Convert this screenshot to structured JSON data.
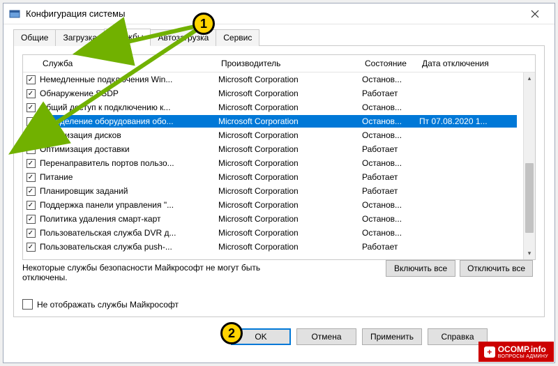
{
  "window": {
    "title": "Конфигурация системы"
  },
  "tabs": {
    "t0": "Общие",
    "t1": "Загрузка",
    "t2": "Службы",
    "t3": "Автозагрузка",
    "t4": "Сервис"
  },
  "columns": {
    "service": "Служба",
    "manufacturer": "Производитель",
    "status": "Состояние",
    "date": "Дата отключения"
  },
  "rows": [
    {
      "checked": true,
      "svc": "Немедленные подключения Win...",
      "mfr": "Microsoft Corporation",
      "state": "Останов...",
      "date": ""
    },
    {
      "checked": true,
      "svc": "Обнаружение SSDP",
      "mfr": "Microsoft Corporation",
      "state": "Работает",
      "date": ""
    },
    {
      "checked": true,
      "svc": "Общий доступ к подключению к...",
      "mfr": "Microsoft Corporation",
      "state": "Останов...",
      "date": ""
    },
    {
      "checked": false,
      "svc": "Определение оборудования обо...",
      "mfr": "Microsoft Corporation",
      "state": "Останов...",
      "date": "Пт 07.08.2020 1...",
      "selected": true
    },
    {
      "checked": true,
      "svc": "Оптимизация дисков",
      "mfr": "Microsoft Corporation",
      "state": "Останов...",
      "date": ""
    },
    {
      "checked": true,
      "svc": "Оптимизация доставки",
      "mfr": "Microsoft Corporation",
      "state": "Работает",
      "date": ""
    },
    {
      "checked": true,
      "svc": "Перенаправитель портов пользо...",
      "mfr": "Microsoft Corporation",
      "state": "Останов...",
      "date": ""
    },
    {
      "checked": true,
      "svc": "Питание",
      "mfr": "Microsoft Corporation",
      "state": "Работает",
      "date": ""
    },
    {
      "checked": true,
      "svc": "Планировщик заданий",
      "mfr": "Microsoft Corporation",
      "state": "Работает",
      "date": ""
    },
    {
      "checked": true,
      "svc": "Поддержка панели управления \"...",
      "mfr": "Microsoft Corporation",
      "state": "Останов...",
      "date": ""
    },
    {
      "checked": true,
      "svc": "Политика удаления смарт-карт",
      "mfr": "Microsoft Corporation",
      "state": "Останов...",
      "date": ""
    },
    {
      "checked": true,
      "svc": "Пользовательская служба DVR д...",
      "mfr": "Microsoft Corporation",
      "state": "Останов...",
      "date": ""
    },
    {
      "checked": true,
      "svc": "Пользовательская служба push-...",
      "mfr": "Microsoft Corporation",
      "state": "Работает",
      "date": ""
    }
  ],
  "hide_ms_label": "Не отображать службы Майкрософт",
  "note_line": "Некоторые службы безопасности Майкрософт не могут быть\nотключены.",
  "actions": {
    "enable_all": "Включить все",
    "disable_all": "Отключить все",
    "ok": "OK",
    "cancel": "Отмена",
    "apply": "Применить",
    "help": "Справка"
  },
  "markers": {
    "m1": "1",
    "m2": "2"
  },
  "watermark": {
    "main": "OCOMP.info",
    "sub": "ВОПРОСЫ АДМИНУ"
  }
}
